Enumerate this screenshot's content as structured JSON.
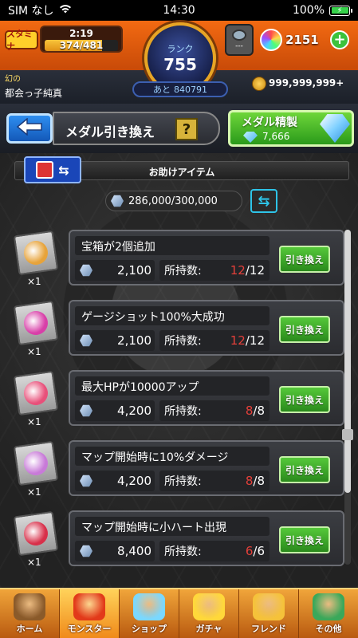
{
  "status_bar": {
    "carrier": "SIM なし",
    "time": "14:30",
    "battery": "100%"
  },
  "header": {
    "stamina_label": "スタミナ",
    "stamina_timer": "2:19",
    "stamina_value": "374/481",
    "stamina_fraction": 0.78,
    "user_label": "幻の",
    "user_name": "都会っ子純真",
    "rank_label": "ランク",
    "rank_value": "755",
    "rank_next_label": "あと",
    "rank_next_value": "840791",
    "device_label": "---",
    "orb_count": "2151",
    "coin_count": "999,999,999+"
  },
  "title_row": {
    "page_title": "メダル引き換え",
    "help_label": "?",
    "refine_label": "メダル精製",
    "refine_count": "7,666"
  },
  "main": {
    "section_title": "お助けアイテム",
    "medal_total": "286,000/300,000",
    "exchange_label": "引き換え",
    "owned_label": "所持数:",
    "items": [
      {
        "name": "宝箱が2個追加",
        "cost": "2,100",
        "owned": "12",
        "max": "/12",
        "qty": "×1",
        "color": "#e7a33a"
      },
      {
        "name": "ゲージショット100%大成功",
        "cost": "2,100",
        "owned": "12",
        "max": "/12",
        "qty": "×1",
        "color": "#d83fa8"
      },
      {
        "name": "最大HPが10000アップ",
        "cost": "4,200",
        "owned": "8",
        "max": "/8",
        "qty": "×1",
        "color": "#e8507a"
      },
      {
        "name": "マップ開始時に10%ダメージ",
        "cost": "4,200",
        "owned": "8",
        "max": "/8",
        "qty": "×1",
        "color": "#c87ad8"
      },
      {
        "name": "マップ開始時に小ハート出現",
        "cost": "8,400",
        "owned": "6",
        "max": "/6",
        "qty": "×1",
        "color": "#d8304a"
      }
    ]
  },
  "bottom_nav": [
    {
      "label": "ホーム",
      "color": "#8a5a2a"
    },
    {
      "label": "モンスター",
      "color": "#e23a1a"
    },
    {
      "label": "ショップ",
      "color": "#7ad8ff"
    },
    {
      "label": "ガチャ",
      "color": "#ffd83a"
    },
    {
      "label": "フレンド",
      "color": "#f5c23a"
    },
    {
      "label": "その他",
      "color": "#3aa85a"
    }
  ]
}
